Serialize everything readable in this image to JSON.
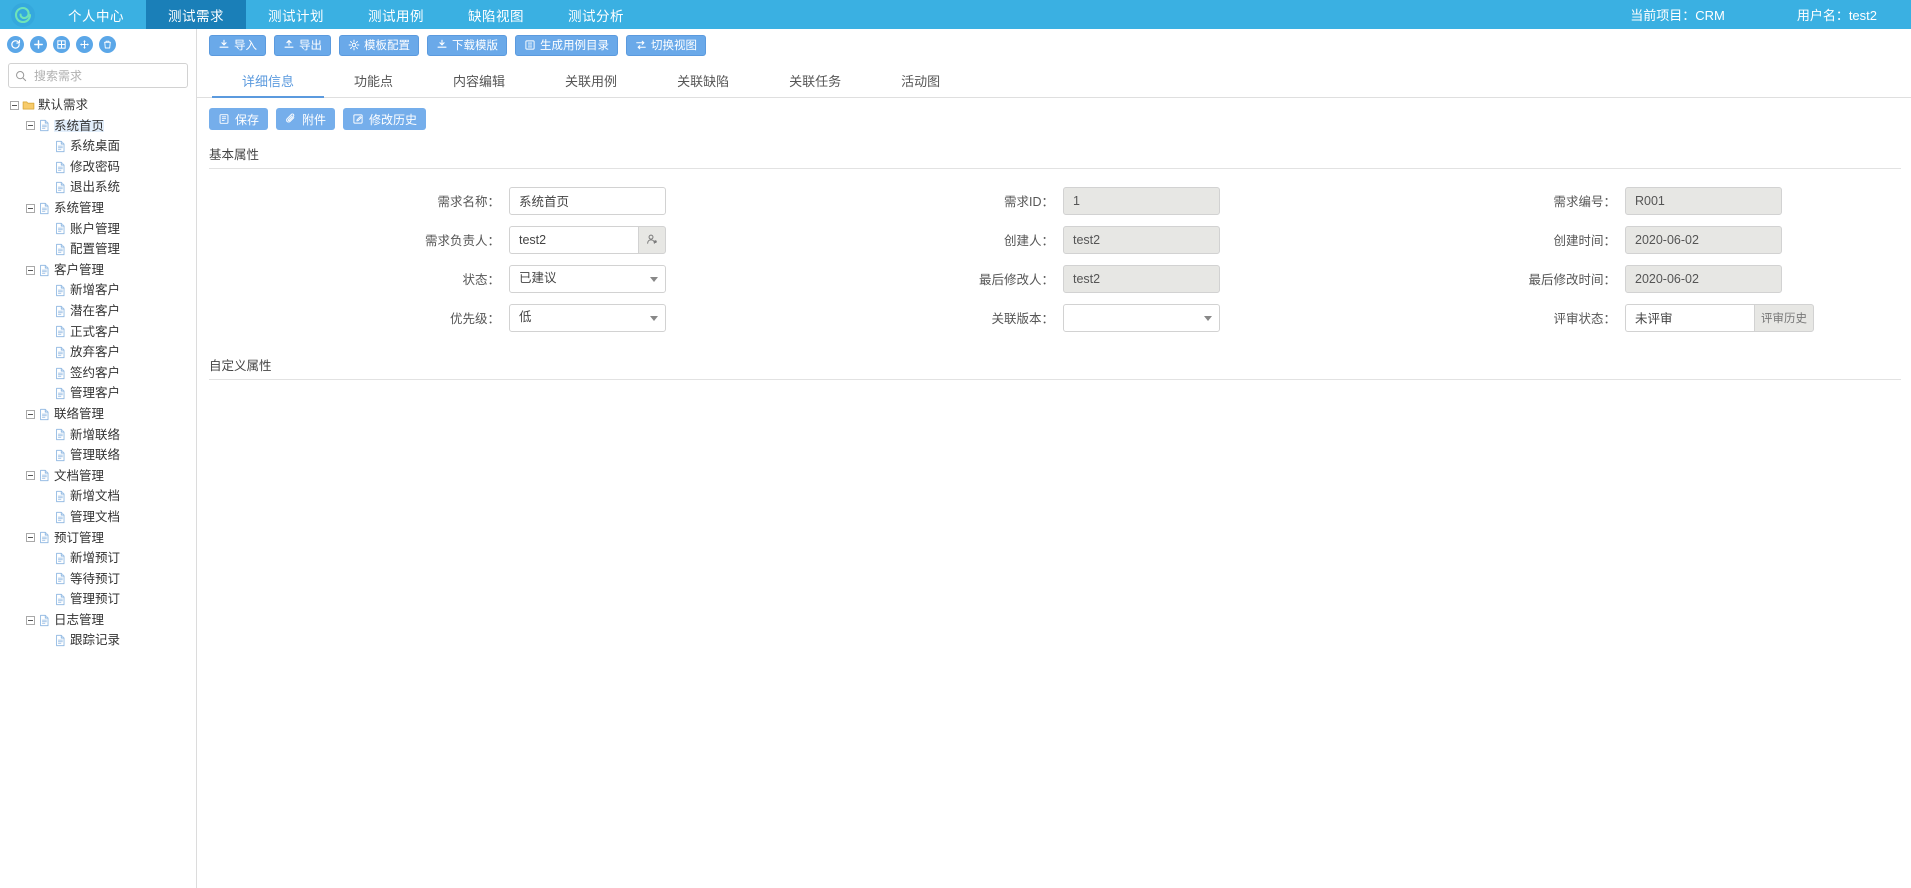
{
  "topnav": {
    "logo_icon": "spiral-logo-icon",
    "items": [
      {
        "label": "个人中心",
        "active": false
      },
      {
        "label": "测试需求",
        "active": true
      },
      {
        "label": "测试计划",
        "active": false
      },
      {
        "label": "测试用例",
        "active": false
      },
      {
        "label": "缺陷视图",
        "active": false
      },
      {
        "label": "测试分析",
        "active": false
      }
    ],
    "current_project": "当前项目：CRM",
    "username": "用户名：test2",
    "accent_color": "#3ab0e2",
    "active_color": "#1a7fb8"
  },
  "sidebar": {
    "tools": [
      {
        "name": "refresh-icon",
        "title": "刷新"
      },
      {
        "name": "add-icon",
        "title": "新增"
      },
      {
        "name": "grid-icon",
        "title": "批量"
      },
      {
        "name": "move-icon",
        "title": "移动"
      },
      {
        "name": "trash-icon",
        "title": "删除"
      }
    ],
    "search": {
      "placeholder": "搜索需求",
      "value": "",
      "icon": "search-icon"
    },
    "tree": [
      {
        "label": "默认需求",
        "depth": 0,
        "icon": "folder-icon",
        "expandable": true,
        "selected": false
      },
      {
        "label": "系统首页",
        "depth": 1,
        "icon": "file-icon",
        "expandable": true,
        "selected": true
      },
      {
        "label": "系统桌面",
        "depth": 2,
        "icon": "file-icon",
        "expandable": false,
        "selected": false
      },
      {
        "label": "修改密码",
        "depth": 2,
        "icon": "file-icon",
        "expandable": false,
        "selected": false
      },
      {
        "label": "退出系统",
        "depth": 2,
        "icon": "file-icon",
        "expandable": false,
        "selected": false
      },
      {
        "label": "系统管理",
        "depth": 1,
        "icon": "file-icon",
        "expandable": true,
        "selected": false
      },
      {
        "label": "账户管理",
        "depth": 2,
        "icon": "file-icon",
        "expandable": false,
        "selected": false
      },
      {
        "label": "配置管理",
        "depth": 2,
        "icon": "file-icon",
        "expandable": false,
        "selected": false
      },
      {
        "label": "客户管理",
        "depth": 1,
        "icon": "file-icon",
        "expandable": true,
        "selected": false
      },
      {
        "label": "新增客户",
        "depth": 2,
        "icon": "file-icon",
        "expandable": false,
        "selected": false
      },
      {
        "label": "潜在客户",
        "depth": 2,
        "icon": "file-icon",
        "expandable": false,
        "selected": false
      },
      {
        "label": "正式客户",
        "depth": 2,
        "icon": "file-icon",
        "expandable": false,
        "selected": false
      },
      {
        "label": "放弃客户",
        "depth": 2,
        "icon": "file-icon",
        "expandable": false,
        "selected": false
      },
      {
        "label": "签约客户",
        "depth": 2,
        "icon": "file-icon",
        "expandable": false,
        "selected": false
      },
      {
        "label": "管理客户",
        "depth": 2,
        "icon": "file-icon",
        "expandable": false,
        "selected": false
      },
      {
        "label": "联络管理",
        "depth": 1,
        "icon": "file-icon",
        "expandable": true,
        "selected": false
      },
      {
        "label": "新增联络",
        "depth": 2,
        "icon": "file-icon",
        "expandable": false,
        "selected": false
      },
      {
        "label": "管理联络",
        "depth": 2,
        "icon": "file-icon",
        "expandable": false,
        "selected": false
      },
      {
        "label": "文档管理",
        "depth": 1,
        "icon": "file-icon",
        "expandable": true,
        "selected": false
      },
      {
        "label": "新增文档",
        "depth": 2,
        "icon": "file-icon",
        "expandable": false,
        "selected": false
      },
      {
        "label": "管理文档",
        "depth": 2,
        "icon": "file-icon",
        "expandable": false,
        "selected": false
      },
      {
        "label": "预订管理",
        "depth": 1,
        "icon": "file-icon",
        "expandable": true,
        "selected": false
      },
      {
        "label": "新增预订",
        "depth": 2,
        "icon": "file-icon",
        "expandable": false,
        "selected": false
      },
      {
        "label": "等待预订",
        "depth": 2,
        "icon": "file-icon",
        "expandable": false,
        "selected": false
      },
      {
        "label": "管理预订",
        "depth": 2,
        "icon": "file-icon",
        "expandable": false,
        "selected": false
      },
      {
        "label": "日志管理",
        "depth": 1,
        "icon": "file-icon",
        "expandable": true,
        "selected": false
      },
      {
        "label": "跟踪记录",
        "depth": 2,
        "icon": "file-icon",
        "expandable": false,
        "selected": false
      }
    ]
  },
  "toolbar": {
    "buttons": [
      {
        "label": "导入",
        "icon": "import-icon"
      },
      {
        "label": "导出",
        "icon": "export-icon"
      },
      {
        "label": "模板配置",
        "icon": "gear-icon"
      },
      {
        "label": "下载模版",
        "icon": "download-icon"
      },
      {
        "label": "生成用例目录",
        "icon": "list-icon"
      },
      {
        "label": "切换视图",
        "icon": "switch-icon"
      }
    ]
  },
  "tabs": [
    {
      "label": "详细信息",
      "active": true
    },
    {
      "label": "功能点",
      "active": false
    },
    {
      "label": "内容编辑",
      "active": false
    },
    {
      "label": "关联用例",
      "active": false
    },
    {
      "label": "关联缺陷",
      "active": false
    },
    {
      "label": "关联任务",
      "active": false
    },
    {
      "label": "活动图",
      "active": false
    }
  ],
  "actions": [
    {
      "label": "保存",
      "icon": "save-icon"
    },
    {
      "label": "附件",
      "icon": "paperclip-icon"
    },
    {
      "label": "修改历史",
      "icon": "edit-history-icon"
    }
  ],
  "sections": {
    "basic_title": "基本属性",
    "custom_title": "自定义属性"
  },
  "form": {
    "rows": [
      [
        {
          "label": "需求名称：",
          "value": "系统首页",
          "type": "text",
          "readonly": false
        },
        {
          "label": "需求ID：",
          "value": "1",
          "type": "text",
          "readonly": true
        },
        {
          "label": "需求编号：",
          "value": "R001",
          "type": "text",
          "readonly": true
        }
      ],
      [
        {
          "label": "需求负责人：",
          "value": "test2",
          "type": "text-button",
          "readonly": false,
          "button_icon": "user-picker-icon"
        },
        {
          "label": "创建人：",
          "value": "test2",
          "type": "text",
          "readonly": true
        },
        {
          "label": "创建时间：",
          "value": "2020-06-02",
          "type": "text",
          "readonly": true
        }
      ],
      [
        {
          "label": "状态：",
          "value": "已建议",
          "type": "select",
          "readonly": false
        },
        {
          "label": "最后修改人：",
          "value": "test2",
          "type": "text",
          "readonly": true
        },
        {
          "label": "最后修改时间：",
          "value": "2020-06-02",
          "type": "text",
          "readonly": true
        }
      ],
      [
        {
          "label": "优先级：",
          "value": "低",
          "type": "select",
          "readonly": false
        },
        {
          "label": "关联版本：",
          "value": "",
          "type": "select",
          "readonly": false
        },
        {
          "label": "评审状态：",
          "value": "未评审",
          "type": "text-button",
          "readonly": false,
          "button_label": "评审历史"
        }
      ]
    ]
  }
}
